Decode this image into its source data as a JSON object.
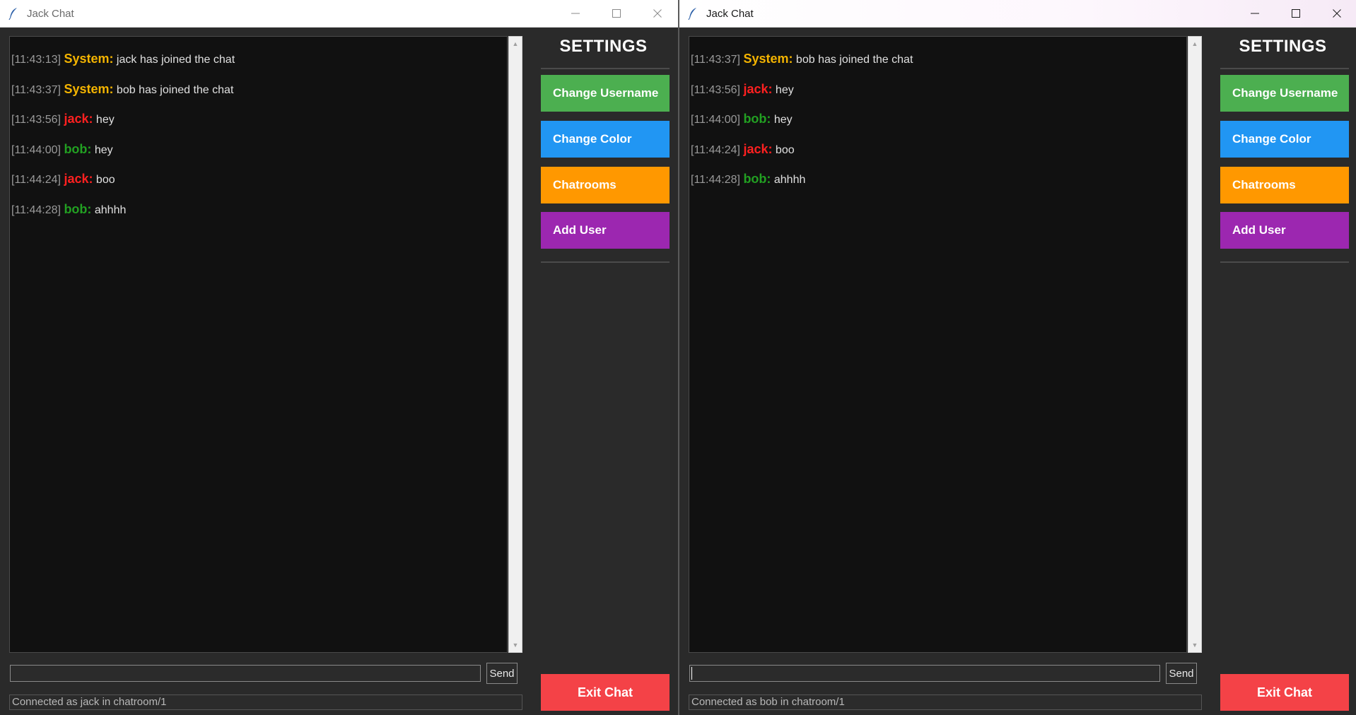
{
  "colors": {
    "system": "#f4b400",
    "jack": "#ff2020",
    "bob": "#22a022",
    "change_username": "#4caf50",
    "change_color": "#2196f3",
    "chatrooms": "#ff9800",
    "add_user": "#9c27b0",
    "exit_chat": "#f44247"
  },
  "windows": [
    {
      "title": "Jack Chat",
      "active": false,
      "settings_title": "SETTINGS",
      "buttons": {
        "change_username": "Change Username",
        "change_color": "Change Color",
        "chatrooms": "Chatrooms",
        "add_user": "Add User",
        "exit_chat": "Exit Chat"
      },
      "send_label": "Send",
      "input_value": "",
      "status": "Connected as jack in chatroom/1",
      "messages": [
        {
          "time": "[11:43:13]",
          "user": "System:",
          "user_key": "system",
          "text": "jack has joined the chat"
        },
        {
          "time": "[11:43:37]",
          "user": "System:",
          "user_key": "system",
          "text": "bob has joined the chat"
        },
        {
          "time": "[11:43:56]",
          "user": "jack:",
          "user_key": "jack",
          "text": "hey"
        },
        {
          "time": "[11:44:00]",
          "user": "bob:",
          "user_key": "bob",
          "text": "hey"
        },
        {
          "time": "[11:44:24]",
          "user": "jack:",
          "user_key": "jack",
          "text": "boo"
        },
        {
          "time": "[11:44:28]",
          "user": "bob:",
          "user_key": "bob",
          "text": "ahhhh"
        }
      ]
    },
    {
      "title": "Jack Chat",
      "active": true,
      "settings_title": "SETTINGS",
      "buttons": {
        "change_username": "Change Username",
        "change_color": "Change Color",
        "chatrooms": "Chatrooms",
        "add_user": "Add User",
        "exit_chat": "Exit Chat"
      },
      "send_label": "Send",
      "input_value": "",
      "status": "Connected as bob in chatroom/1",
      "messages": [
        {
          "time": "[11:43:37]",
          "user": "System:",
          "user_key": "system",
          "text": "bob has joined the chat"
        },
        {
          "time": "[11:43:56]",
          "user": "jack:",
          "user_key": "jack",
          "text": "hey"
        },
        {
          "time": "[11:44:00]",
          "user": "bob:",
          "user_key": "bob",
          "text": "hey"
        },
        {
          "time": "[11:44:24]",
          "user": "jack:",
          "user_key": "jack",
          "text": "boo"
        },
        {
          "time": "[11:44:28]",
          "user": "bob:",
          "user_key": "bob",
          "text": "ahhhh"
        }
      ]
    }
  ],
  "icons": {
    "app": "feather-icon",
    "minimize": "minimize-icon",
    "maximize": "maximize-icon",
    "close": "close-icon",
    "scroll_up": "scroll-up-arrow-icon",
    "scroll_down": "scroll-down-arrow-icon"
  }
}
